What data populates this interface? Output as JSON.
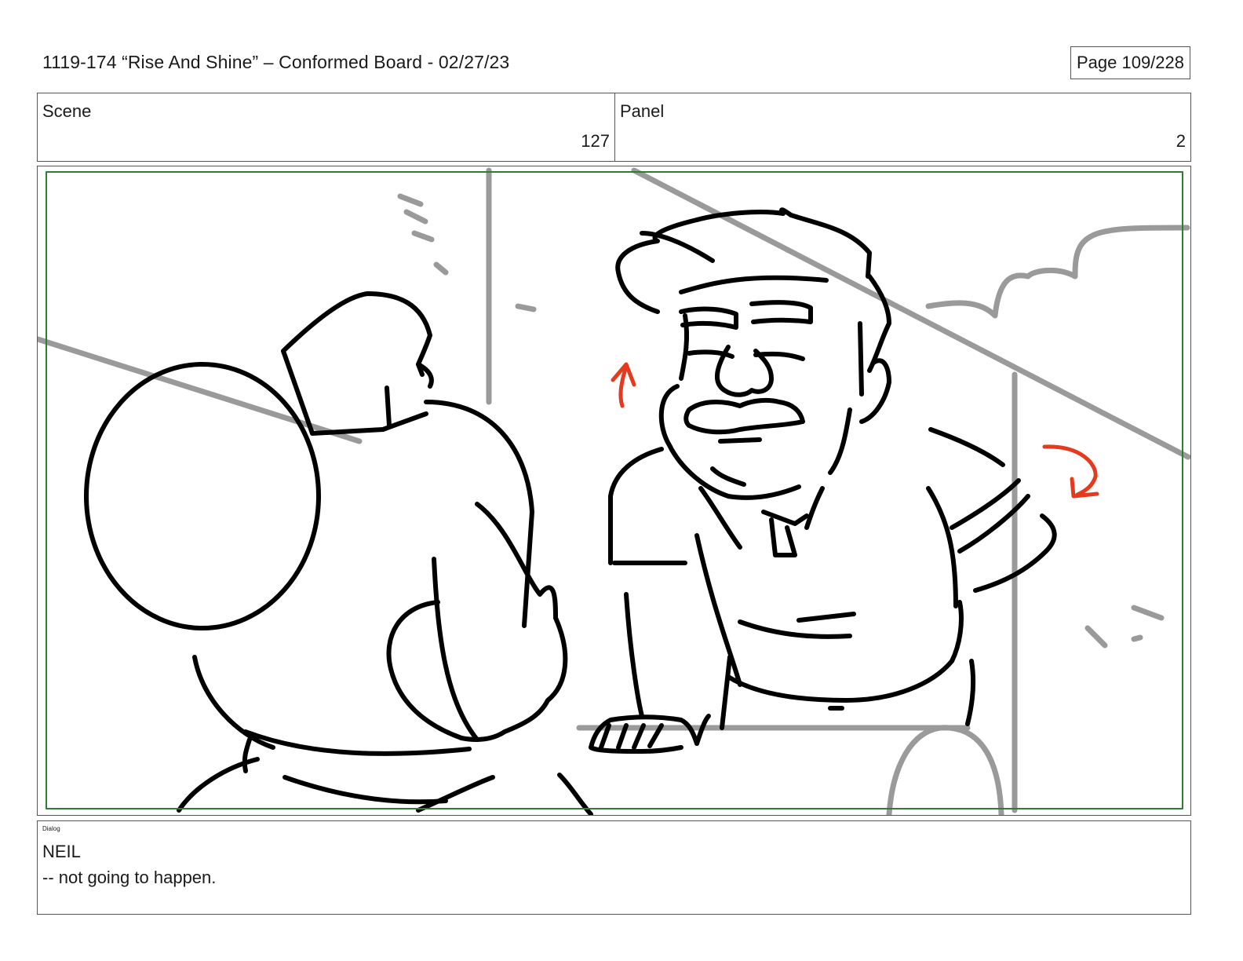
{
  "header": {
    "title": "1119-174 “Rise And Shine” – Conformed Board - 02/27/23",
    "page": "Page 109/228"
  },
  "info": {
    "scene_label": "Scene",
    "scene_value": "127",
    "panel_label": "Panel",
    "panel_value": "2"
  },
  "panel": {
    "safe_frame_color": "#2e7d32",
    "ink_color": "#000000",
    "background_color": "#9a9a9a",
    "arrow_color": "#e53a1e",
    "icons": [
      "character-back-view-icon",
      "neil-character-icon",
      "up-arrow-icon",
      "curved-down-arrow-icon"
    ]
  },
  "dialog": {
    "tag": "Dialog",
    "speaker": "NEIL",
    "line": "-- not going to happen."
  }
}
